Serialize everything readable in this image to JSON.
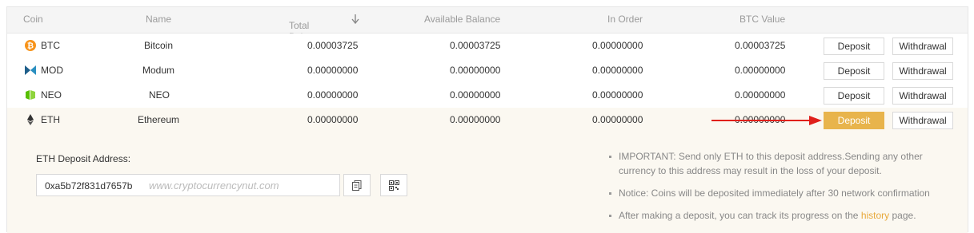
{
  "headers": {
    "coin": "Coin",
    "name": "Name",
    "total": "Total Balance",
    "available": "Available Balance",
    "in_order": "In Order",
    "btc_value": "BTC Value"
  },
  "rows": [
    {
      "symbol": "BTC",
      "name": "Bitcoin",
      "total": "0.00003725",
      "available": "0.00003725",
      "in_order": "0.00000000",
      "btc_value": "0.00003725",
      "icon": "bitcoin-icon",
      "color": "#f7931a"
    },
    {
      "symbol": "MOD",
      "name": "Modum",
      "total": "0.00000000",
      "available": "0.00000000",
      "in_order": "0.00000000",
      "btc_value": "0.00000000",
      "icon": "modum-icon",
      "color": "#1a5a8a"
    },
    {
      "symbol": "NEO",
      "name": "NEO",
      "total": "0.00000000",
      "available": "0.00000000",
      "in_order": "0.00000000",
      "btc_value": "0.00000000",
      "icon": "neo-icon",
      "color": "#58bf00"
    },
    {
      "symbol": "ETH",
      "name": "Ethereum",
      "total": "0.00000000",
      "available": "0.00000000",
      "in_order": "0.00000000",
      "btc_value": "0.00000000",
      "icon": "ethereum-icon",
      "color": "#333333"
    }
  ],
  "buttons": {
    "deposit": "Deposit",
    "withdrawal": "Withdrawal"
  },
  "deposit_panel": {
    "label": "ETH Deposit Address:",
    "address": "0xa5b72f831d7657b",
    "watermark": "www.cryptocurrencynut.com",
    "notes": [
      "IMPORTANT: Send only ETH to this deposit address.Sending any other currency to this address may result in the loss of your deposit.",
      "Notice: Coins will be deposited immediately after 30 network confirmation"
    ],
    "note3_prefix": "After making a deposit, you can track its progress on the ",
    "note3_link": "history",
    "note3_suffix": " page."
  },
  "colors": {
    "accent": "#e8b44c",
    "arrow": "#e0201b"
  }
}
